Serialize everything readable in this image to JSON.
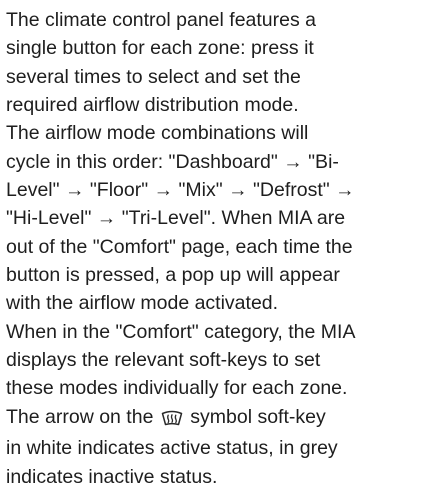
{
  "paragraphs": [
    {
      "lines": [
        "The climate control panel features a",
        "single button for each zone: press it",
        "several times to select and set the",
        "required airflow distribution mode."
      ]
    },
    {
      "lines": [
        "The airflow mode combinations will",
        "cycle in this order: \"Dashboard\" → \"Bi-",
        "Level\" → \"Floor\" → \"Mix\" → \"Defrost\" →",
        "\"Hi-Level\" → \"Tri-Level\". When MIA are",
        "out of the \"Comfort\" page, each time the",
        "button is pressed, a pop up will appear",
        "with the airflow mode activated."
      ]
    },
    {
      "lines": [
        "When in the \"Comfort\" category, the MIA",
        "displays the relevant soft-keys to set",
        "these modes individually for each zone."
      ]
    },
    {
      "line_before_icon": "The arrow on the ",
      "icon": "windshield-defrost-icon",
      "line_after_icon": " symbol soft-key",
      "lines": [
        "in white indicates active status, in grey",
        "indicates inactive status."
      ]
    }
  ]
}
